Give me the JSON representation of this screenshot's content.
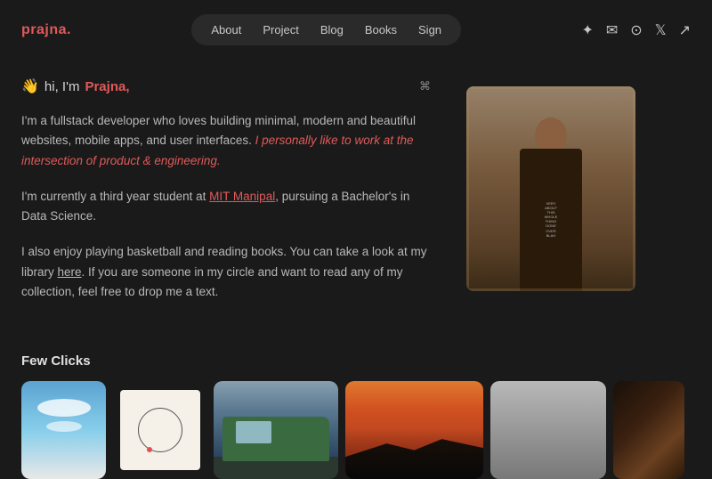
{
  "nav": {
    "logo": "prajna",
    "logo_dot": ".",
    "links": [
      {
        "label": "About",
        "href": "#about"
      },
      {
        "label": "Project",
        "href": "#project"
      },
      {
        "label": "Blog",
        "href": "#blog"
      },
      {
        "label": "Books",
        "href": "#books"
      },
      {
        "label": "Sign",
        "href": "#sign"
      }
    ],
    "icons": [
      "sun-icon",
      "email-icon",
      "github-icon",
      "twitter-icon",
      "chart-icon"
    ]
  },
  "hero": {
    "greeting_emoji": "👋",
    "greeting_prefix": "hi, I'm ",
    "greeting_name": "Prajna,",
    "cmd_symbol": "⌘",
    "para1_start": "I'm a fullstack developer who loves building minimal, modern and beautiful websites, mobile apps, and user interfaces.",
    "para1_highlight": " I personally like to work at the intersection of product & engineering.",
    "para2_start": "I'm currently a third year student at ",
    "para2_link": "MIT Manipal",
    "para2_end": ", pursuing a Bachelor's in Data Science.",
    "para3_start": "I also enjoy playing basketball and reading books. You can take a look at my library ",
    "para3_link": "here",
    "para3_end": ". If you are someone in my circle and want to read any of my collection, feel free to drop me a text."
  },
  "few_clicks": {
    "title": "Few Clicks"
  }
}
